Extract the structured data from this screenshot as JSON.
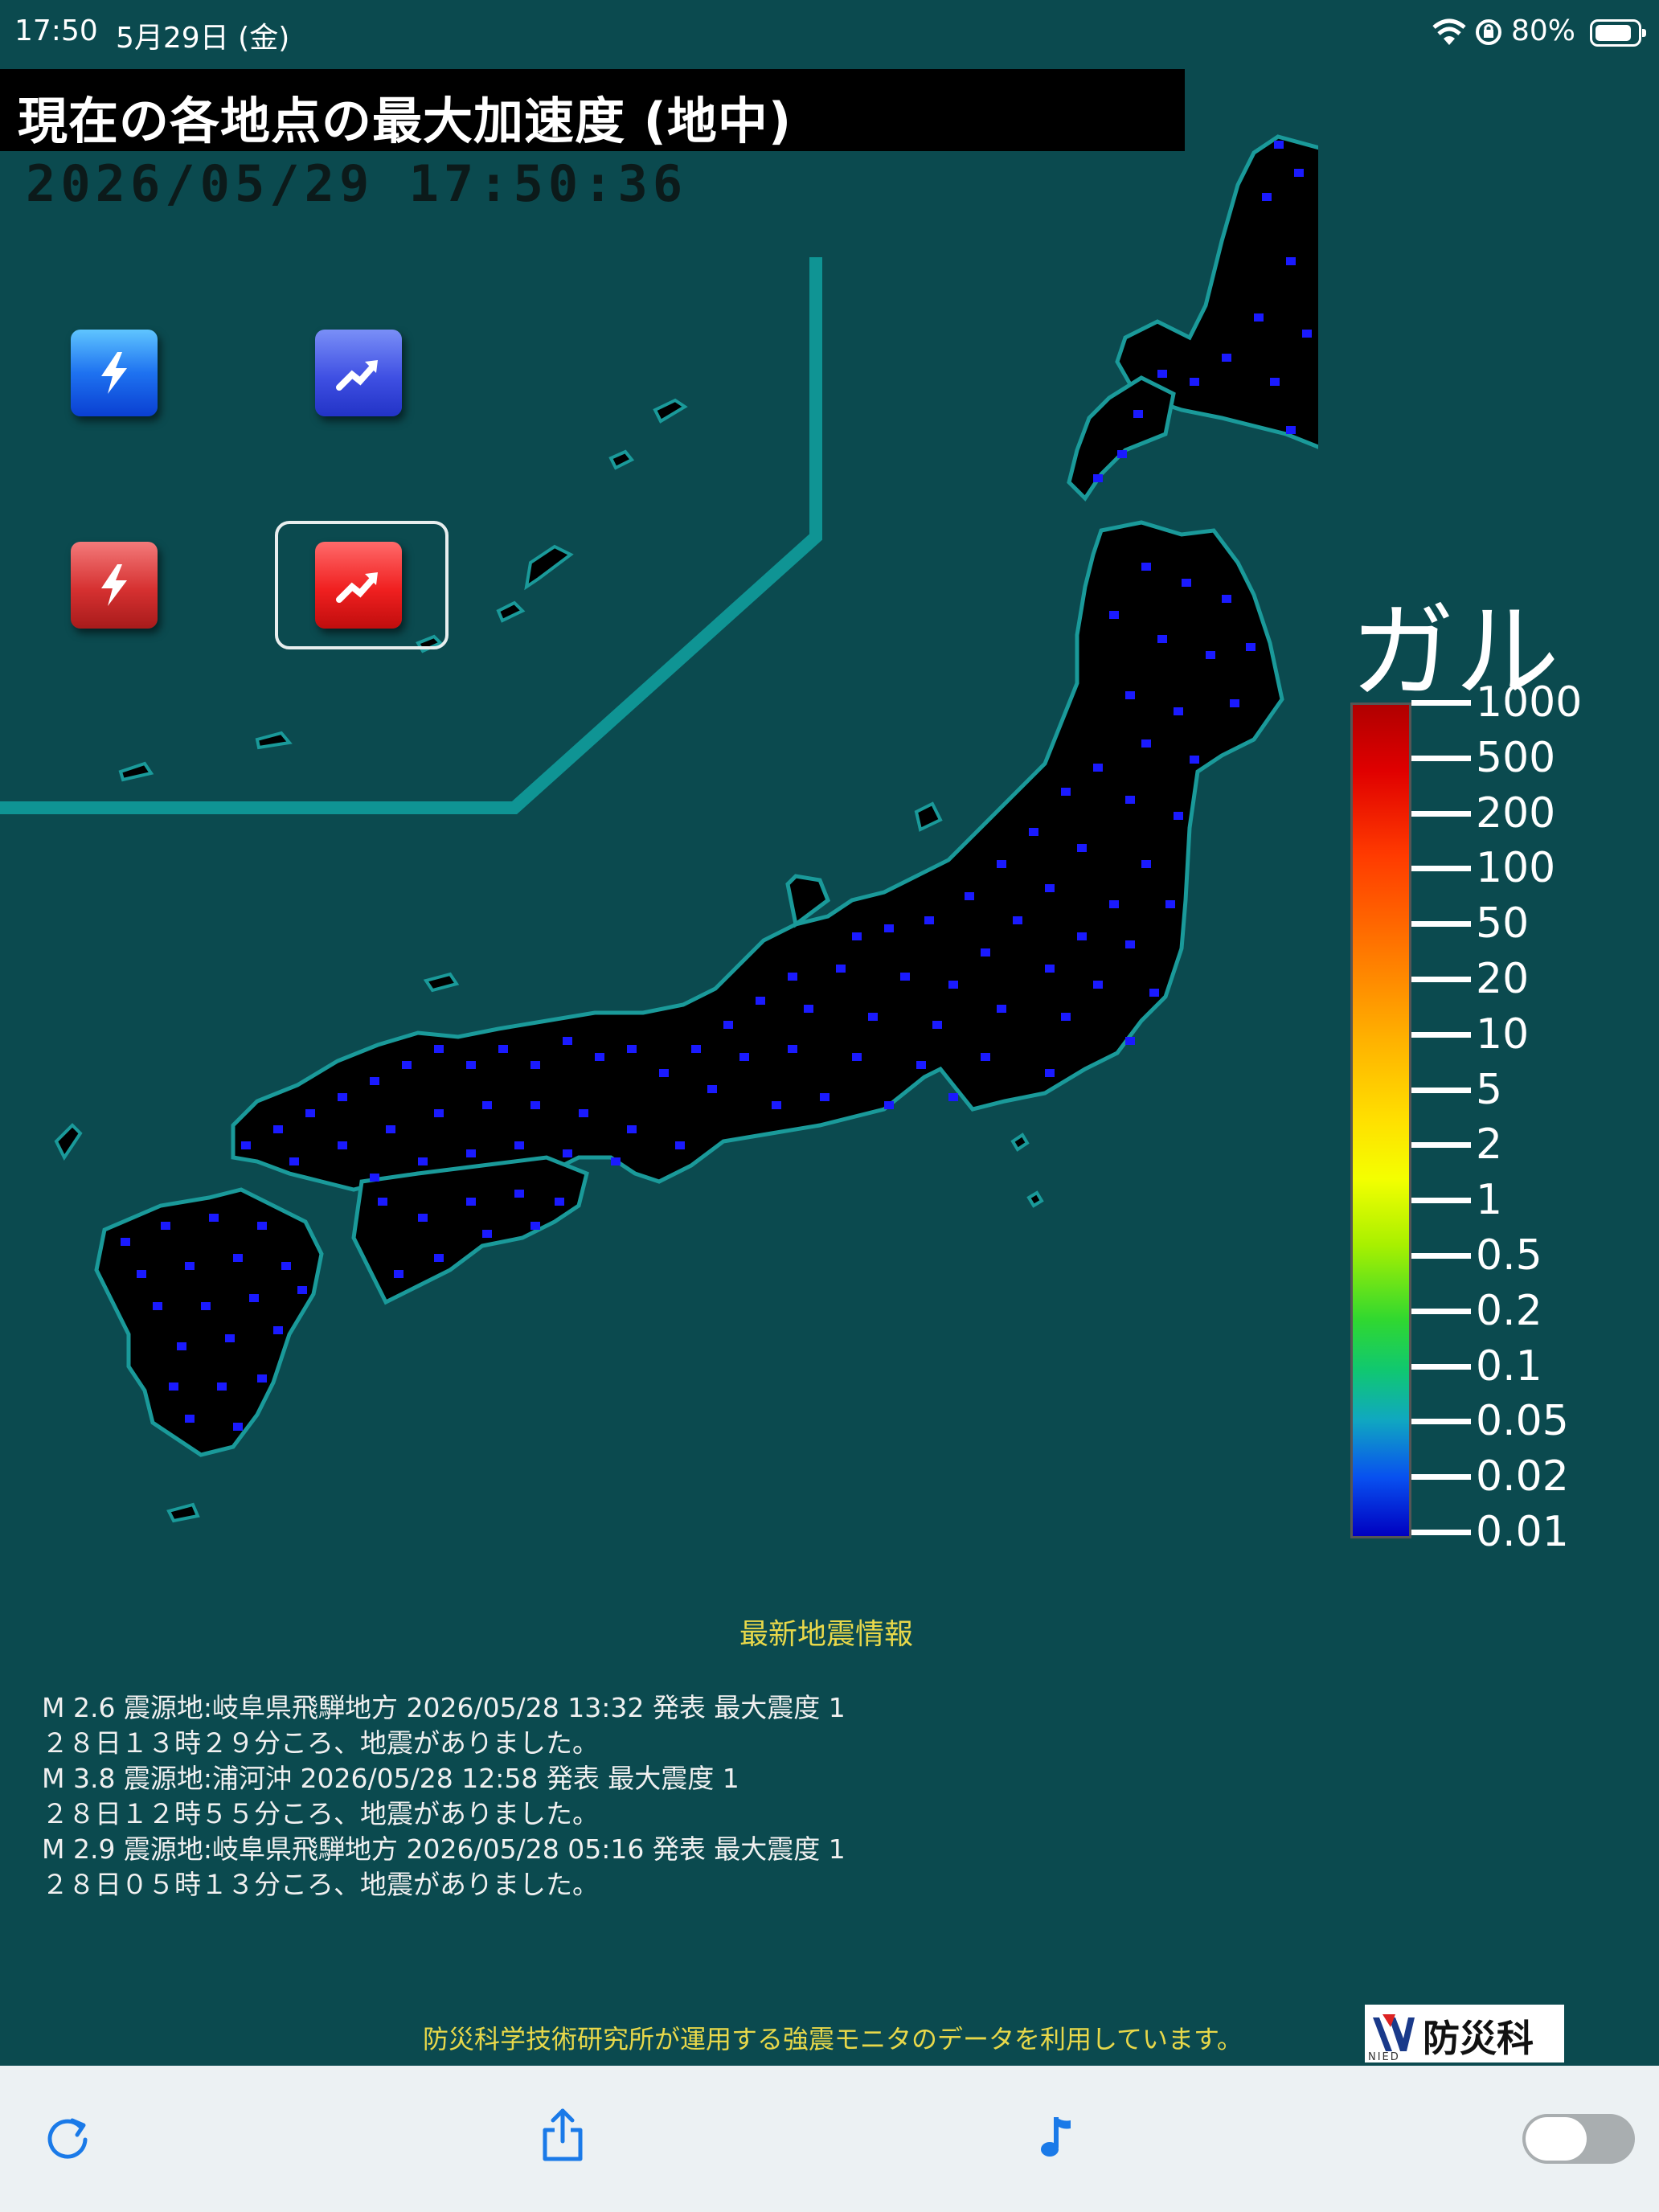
{
  "status_bar": {
    "time": "17:50",
    "date": "5月29日 (金)",
    "battery_percent": "80%",
    "battery_level": 0.8
  },
  "header": {
    "title": "現在の各地点の最大加速度 (地中)",
    "timestamp": "2026/05/29 17:50:36"
  },
  "controls": [
    {
      "name": "realtime-blue-button",
      "icon": "lightning-icon",
      "selected": false
    },
    {
      "name": "max-blue-button",
      "icon": "trend-up-icon",
      "selected": false
    },
    {
      "name": "realtime-red-button",
      "icon": "lightning-icon",
      "selected": false
    },
    {
      "name": "max-red-button",
      "icon": "trend-up-icon",
      "selected": true
    }
  ],
  "scale": {
    "unit_title": "ガル",
    "labels": [
      "1000",
      "500",
      "200",
      "100",
      "50",
      "20",
      "10",
      "5",
      "2",
      "1",
      "0.5",
      "0.2",
      "0.1",
      "0.05",
      "0.02",
      "0.01"
    ]
  },
  "news": {
    "title": "最新地震情報",
    "lines": [
      "M 2.6 震源地:岐阜県飛騨地方 2026/05/28 13:32 発表 最大震度 1",
      "２８日１３時２９分ころ、地震がありました。",
      "M 3.8 震源地:浦河沖 2026/05/28 12:58 発表 最大震度 1",
      "２８日１２時５５分ころ、地震がありました。",
      "M 2.9 震源地:岐阜県飛騨地方 2026/05/28 05:16 発表 最大震度 1",
      "２８日０５時１３分ころ、地震がありました。"
    ]
  },
  "footer": {
    "credit": "防災科学技術研究所が運用する強震モニタのデータを利用しています。",
    "logo_text": "防災科研",
    "logo_small": "NIED"
  },
  "toolbar": {
    "icons": [
      "refresh-icon",
      "share-icon",
      "music-note-icon"
    ],
    "toggle_on": false
  },
  "colors": {
    "background": "#0b4a4f",
    "land": "#000000",
    "coast": "#1a9a9a",
    "station": "#1a1aff",
    "news_title": "#e8d84a"
  }
}
